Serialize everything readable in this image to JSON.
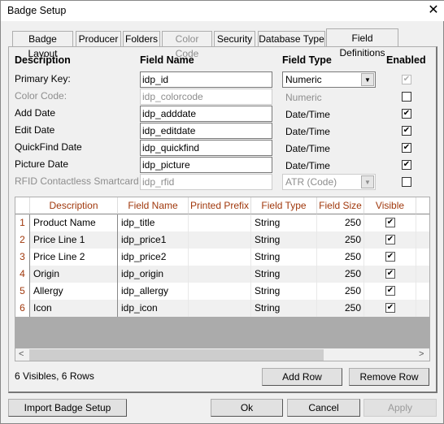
{
  "window": {
    "title": "Badge Setup",
    "close_icon": "close-icon"
  },
  "tabs": [
    {
      "label": "Badge Layout",
      "enabled": true
    },
    {
      "label": "Producer",
      "enabled": true
    },
    {
      "label": "Folders",
      "enabled": true
    },
    {
      "label": "Color Code",
      "enabled": false
    },
    {
      "label": "Security",
      "enabled": true
    },
    {
      "label": "Database Type",
      "enabled": true
    },
    {
      "label": "Field Definitions",
      "enabled": true,
      "selected": true
    }
  ],
  "fixed_fields": {
    "headers": {
      "description": "Description",
      "field_name": "Field Name",
      "field_type": "Field Type",
      "enabled": "Enabled"
    },
    "rows": [
      {
        "description": "Primary Key:",
        "field_name": "idp_id",
        "field_type": "Numeric",
        "type_control": "dropdown",
        "enabled": true,
        "disabled": false,
        "checkbox_disabled": true
      },
      {
        "description": "Color Code:",
        "field_name": "idp_colorcode",
        "field_type": "Numeric",
        "type_control": "text",
        "enabled": false,
        "disabled": true
      },
      {
        "description": "Add Date",
        "field_name": "idp_adddate",
        "field_type": "Date/Time",
        "type_control": "text",
        "enabled": true,
        "disabled": false
      },
      {
        "description": "Edit Date",
        "field_name": "idp_editdate",
        "field_type": "Date/Time",
        "type_control": "text",
        "enabled": true,
        "disabled": false
      },
      {
        "description": "QuickFind Date",
        "field_name": "idp_quickfind",
        "field_type": "Date/Time",
        "type_control": "text",
        "enabled": true,
        "disabled": false
      },
      {
        "description": "Picture Date",
        "field_name": "idp_picture",
        "field_type": "Date/Time",
        "type_control": "text",
        "enabled": true,
        "disabled": false
      },
      {
        "description": "RFID Contactless Smartcard",
        "field_name": "idp_rfid",
        "field_type": "ATR (Code)",
        "type_control": "dropdown",
        "enabled": false,
        "disabled": true
      }
    ]
  },
  "grid": {
    "columns": [
      "Description",
      "Field Name",
      "Printed Prefix",
      "Field Type",
      "Field Size",
      "Visible"
    ],
    "rows": [
      {
        "n": "1",
        "description": "Product Name",
        "field_name": "idp_title",
        "prefix": "",
        "field_type": "String",
        "size": "250",
        "visible": true
      },
      {
        "n": "2",
        "description": "Price Line 1",
        "field_name": "idp_price1",
        "prefix": "",
        "field_type": "String",
        "size": "250",
        "visible": true
      },
      {
        "n": "3",
        "description": "Price Line 2",
        "field_name": "idp_price2",
        "prefix": "",
        "field_type": "String",
        "size": "250",
        "visible": true
      },
      {
        "n": "4",
        "description": "Origin",
        "field_name": "idp_origin",
        "prefix": "",
        "field_type": "String",
        "size": "250",
        "visible": true
      },
      {
        "n": "5",
        "description": "Allergy",
        "field_name": "idp_allergy",
        "prefix": "",
        "field_type": "String",
        "size": "250",
        "visible": true
      },
      {
        "n": "6",
        "description": "Icon",
        "field_name": "idp_icon",
        "prefix": "",
        "field_type": "String",
        "size": "250",
        "visible": true
      }
    ],
    "header_color": "#a0380c"
  },
  "status": "6 Visibles, 6 Rows",
  "buttons": {
    "add_row": "Add Row",
    "remove_row": "Remove Row",
    "import": "Import Badge Setup",
    "ok": "Ok",
    "cancel": "Cancel",
    "apply": "Apply"
  }
}
